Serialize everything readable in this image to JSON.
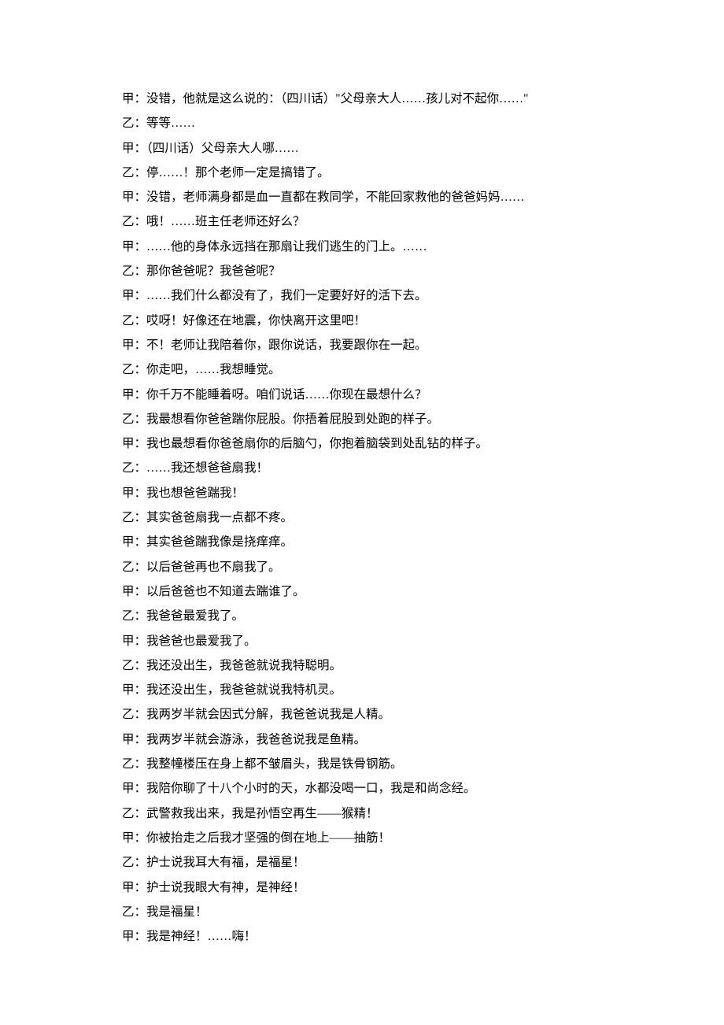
{
  "dialogue": [
    {
      "speaker": "甲",
      "text": "没错，他就是这么说的：（四川话）\"父母亲大人……孩儿对不起你……\""
    },
    {
      "speaker": "乙",
      "text": "等等……"
    },
    {
      "speaker": "甲",
      "text": "（四川话）父母亲大人哪……"
    },
    {
      "speaker": "乙",
      "text": "停……！那个老师一定是搞错了。"
    },
    {
      "speaker": "甲",
      "text": "没错，老师满身都是血一直都在救同学，不能回家救他的爸爸妈妈……"
    },
    {
      "speaker": "乙",
      "text": "哦！……班主任老师还好么？"
    },
    {
      "speaker": "甲",
      "text": "……他的身体永远挡在那扇让我们逃生的门上。……"
    },
    {
      "speaker": "乙",
      "text": "那你爸爸呢？我爸爸呢？"
    },
    {
      "speaker": "甲",
      "text": "……我们什么都没有了，我们一定要好好的活下去。"
    },
    {
      "speaker": "乙",
      "text": "哎呀！好像还在地震，你快离开这里吧！"
    },
    {
      "speaker": "甲",
      "text": "不！老师让我陪着你，跟你说话，我要跟你在一起。"
    },
    {
      "speaker": "乙",
      "text": "你走吧，……我想睡觉。"
    },
    {
      "speaker": "甲",
      "text": "你千万不能睡着呀。咱们说话……你现在最想什么？"
    },
    {
      "speaker": "乙",
      "text": "我最想看你爸爸踹你屁股。你捂着屁股到处跑的样子。"
    },
    {
      "speaker": "甲",
      "text": "我也最想看你爸爸扇你的后脑勺，你抱着脑袋到处乱钻的样子。"
    },
    {
      "speaker": "乙",
      "text": "……我还想爸爸扇我！"
    },
    {
      "speaker": "甲",
      "text": "我也想爸爸踹我！"
    },
    {
      "speaker": "乙",
      "text": "其实爸爸扇我一点都不疼。"
    },
    {
      "speaker": "甲",
      "text": "其实爸爸踹我像是挠痒痒。"
    },
    {
      "speaker": "乙",
      "text": "以后爸爸再也不扇我了。"
    },
    {
      "speaker": "甲",
      "text": "以后爸爸也不知道去踹谁了。"
    },
    {
      "speaker": "乙",
      "text": "我爸爸最爱我了。"
    },
    {
      "speaker": "甲",
      "text": "我爸爸也最爱我了。"
    },
    {
      "speaker": "乙",
      "text": "我还没出生，我爸爸就说我特聪明。"
    },
    {
      "speaker": "甲",
      "text": "我还没出生，我爸爸就说我特机灵。"
    },
    {
      "speaker": "乙",
      "text": "我两岁半就会因式分解，我爸爸说我是人精。"
    },
    {
      "speaker": "甲",
      "text": "我两岁半就会游泳，我爸爸说我是鱼精。"
    },
    {
      "speaker": "乙",
      "text": "我整幢楼压在身上都不皱眉头，我是铁骨钢筋。"
    },
    {
      "speaker": "甲",
      "text": "我陪你聊了十八个小时的天，水都没喝一口，我是和尚念经。"
    },
    {
      "speaker": "乙",
      "text": "武警救我出来，我是孙悟空再生——猴精！"
    },
    {
      "speaker": "甲",
      "text": "你被抬走之后我才坚强的倒在地上——抽筋！"
    },
    {
      "speaker": "乙",
      "text": "护士说我耳大有福，是福星！"
    },
    {
      "speaker": "甲",
      "text": "护士说我眼大有神，是神经！"
    },
    {
      "speaker": "乙",
      "text": "我是福星！"
    },
    {
      "speaker": "甲",
      "text": "我是神经！……嗨！"
    }
  ]
}
